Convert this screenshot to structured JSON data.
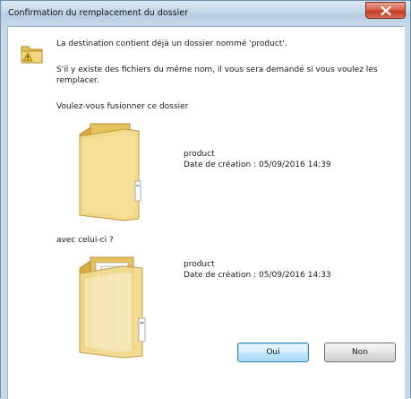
{
  "window": {
    "title": "Confirmation du remplacement du dossier"
  },
  "message": {
    "line1": "La destination contient déjà un dossier nommé 'product'.",
    "line2": "S'il y existe des fichiers du même nom, il vous sera demandé si vous voulez les remplacer.",
    "question": "Voulez-vous fusionner ce dossier"
  },
  "destination_folder": {
    "name": "product",
    "created": "Date de création : 05/09/2016 14:39"
  },
  "with_label": "avec celui-ci ?",
  "source_folder": {
    "name": "product",
    "created": "Date de création : 05/09/2016 14:33"
  },
  "buttons": {
    "yes": "Oui",
    "no": "Non"
  },
  "icons": {
    "warning": "warning-folder-icon",
    "close": "close-icon",
    "destination": "folder-icon",
    "source": "folder-with-files-icon"
  }
}
